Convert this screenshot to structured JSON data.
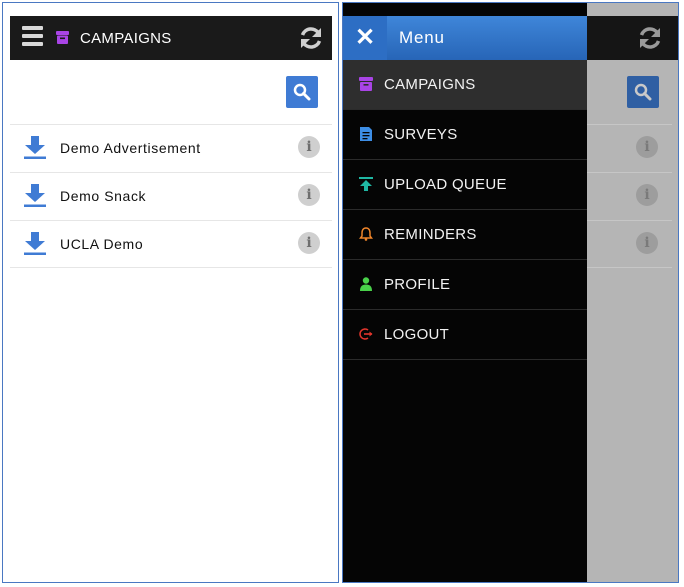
{
  "app": {
    "header_title": "CAMPAIGNS",
    "campaigns": [
      {
        "label": "Demo Advertisement"
      },
      {
        "label": "Demo Snack"
      },
      {
        "label": "UCLA Demo"
      }
    ],
    "info_glyph": "i"
  },
  "drawer": {
    "close_glyph": "✕",
    "title": "Menu",
    "items": [
      {
        "label": "CAMPAIGNS",
        "icon": "campaign-icon",
        "color": "#a944e6",
        "active": true
      },
      {
        "label": "SURVEYS",
        "icon": "survey-icon",
        "color": "#3d8ee6"
      },
      {
        "label": "UPLOAD QUEUE",
        "icon": "upload-icon",
        "color": "#1fb7a3"
      },
      {
        "label": "REMINDERS",
        "icon": "bell-icon",
        "color": "#f0852a"
      },
      {
        "label": "PROFILE",
        "icon": "person-icon",
        "color": "#49d14a"
      },
      {
        "label": "LOGOUT",
        "icon": "logout-icon",
        "color": "#e0352c"
      }
    ]
  },
  "colors": {
    "topbar": "#1a1a1a",
    "accent_blue": "#3f7bd4",
    "download_blue": "#3f7bd4",
    "drawer_bg": "#050505",
    "overlay_dim": "#b5b5b5"
  }
}
